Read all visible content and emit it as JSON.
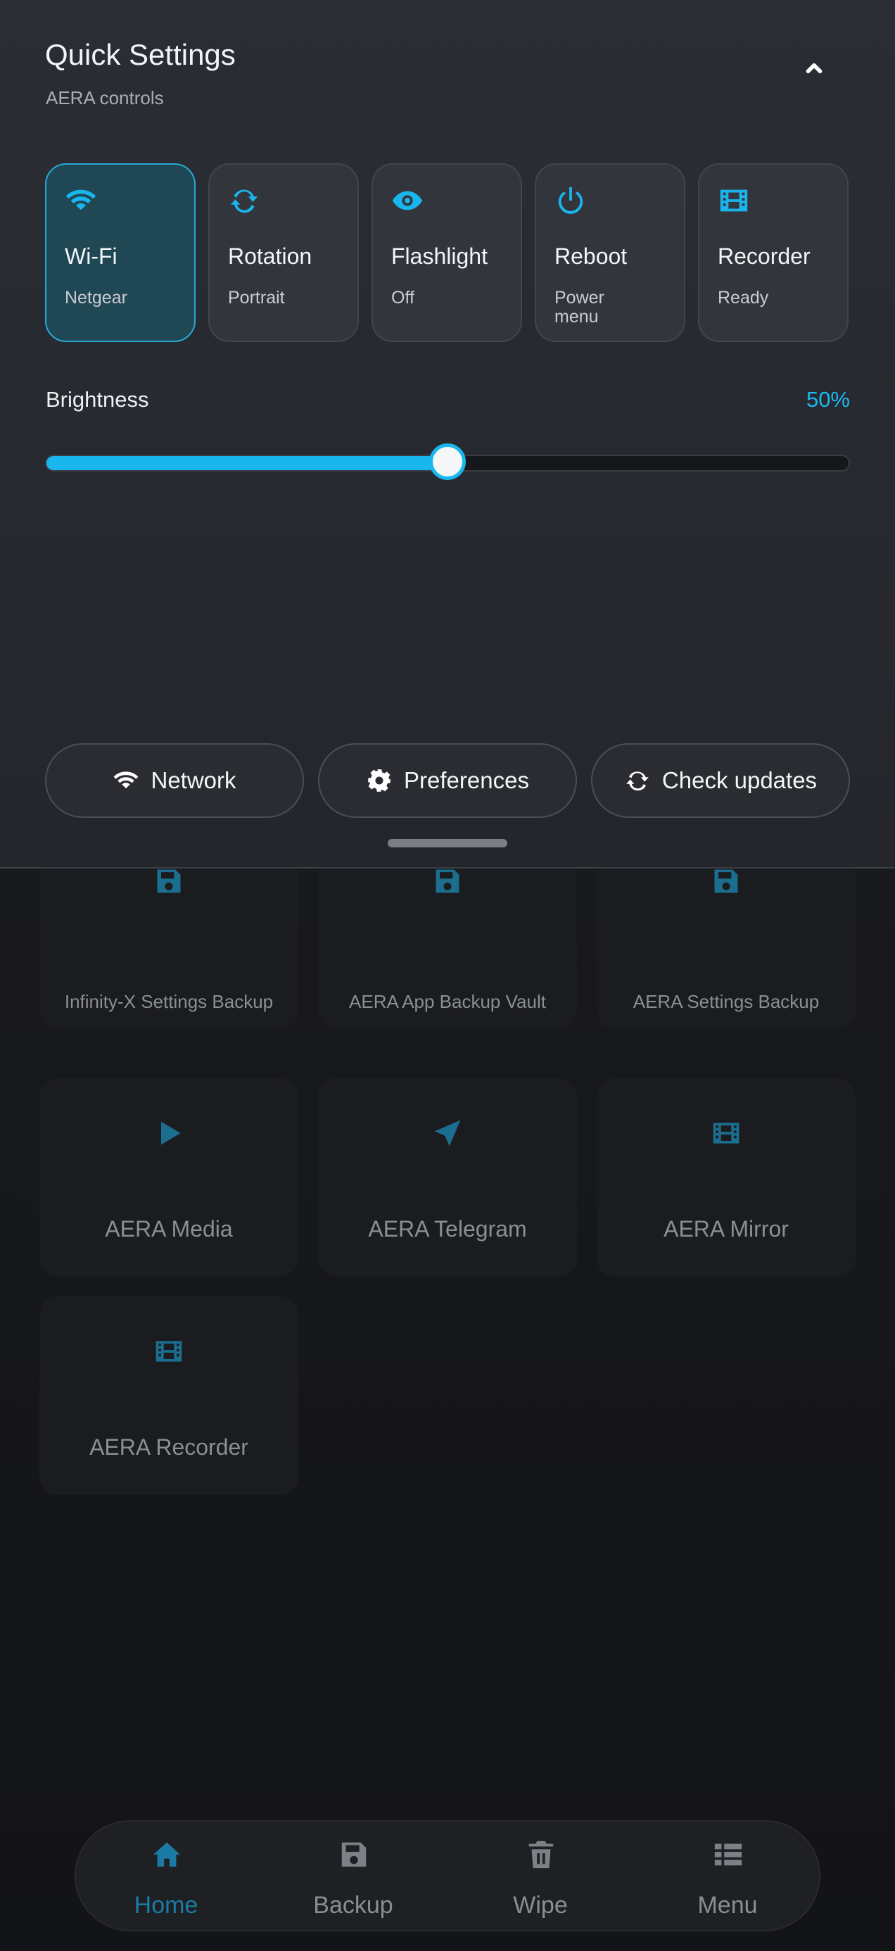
{
  "quick_settings": {
    "title": "Quick Settings",
    "subtitle": "AERA controls",
    "tiles": [
      {
        "icon": "wifi-icon",
        "name": "Wi-Fi",
        "state": "Netgear",
        "active": true
      },
      {
        "icon": "rotation-icon",
        "name": "Rotation",
        "state": "Portrait",
        "active": false
      },
      {
        "icon": "eye-icon",
        "name": "Flashlight",
        "state": "Off",
        "active": false
      },
      {
        "icon": "power-icon",
        "name": "Reboot",
        "state": "Power menu",
        "active": false
      },
      {
        "icon": "film-icon",
        "name": "Recorder",
        "state": "Ready",
        "active": false
      }
    ],
    "brightness": {
      "label": "Brightness",
      "value_text": "50%",
      "value": 0.5
    },
    "actions": [
      {
        "icon": "wifi-icon",
        "label": "Network"
      },
      {
        "icon": "gear-icon",
        "label": "Preferences"
      },
      {
        "icon": "refresh-icon",
        "label": "Check updates"
      }
    ]
  },
  "apps": [
    {
      "icon": "floppy-icon",
      "label": "Infinity-X Settings Backup"
    },
    {
      "icon": "floppy-icon",
      "label": "AERA App Backup Vault"
    },
    {
      "icon": "floppy-icon",
      "label": "AERA Settings Backup"
    },
    {
      "icon": "play-icon",
      "label": "AERA Media"
    },
    {
      "icon": "send-icon",
      "label": "AERA Telegram"
    },
    {
      "icon": "film-icon",
      "label": "AERA Mirror"
    },
    {
      "icon": "film-icon",
      "label": "AERA Recorder"
    }
  ],
  "bottom_nav": [
    {
      "icon": "home-icon",
      "label": "Home",
      "active": true
    },
    {
      "icon": "floppy-icon",
      "label": "Backup",
      "active": false
    },
    {
      "icon": "trash-icon",
      "label": "Wipe",
      "active": false
    },
    {
      "icon": "list-icon",
      "label": "Menu",
      "active": false
    }
  ],
  "colors": {
    "accent": "#1ab7ef",
    "accent_dim": "#1a7ba4",
    "panel": "#2a2d34",
    "background": "#141518"
  }
}
